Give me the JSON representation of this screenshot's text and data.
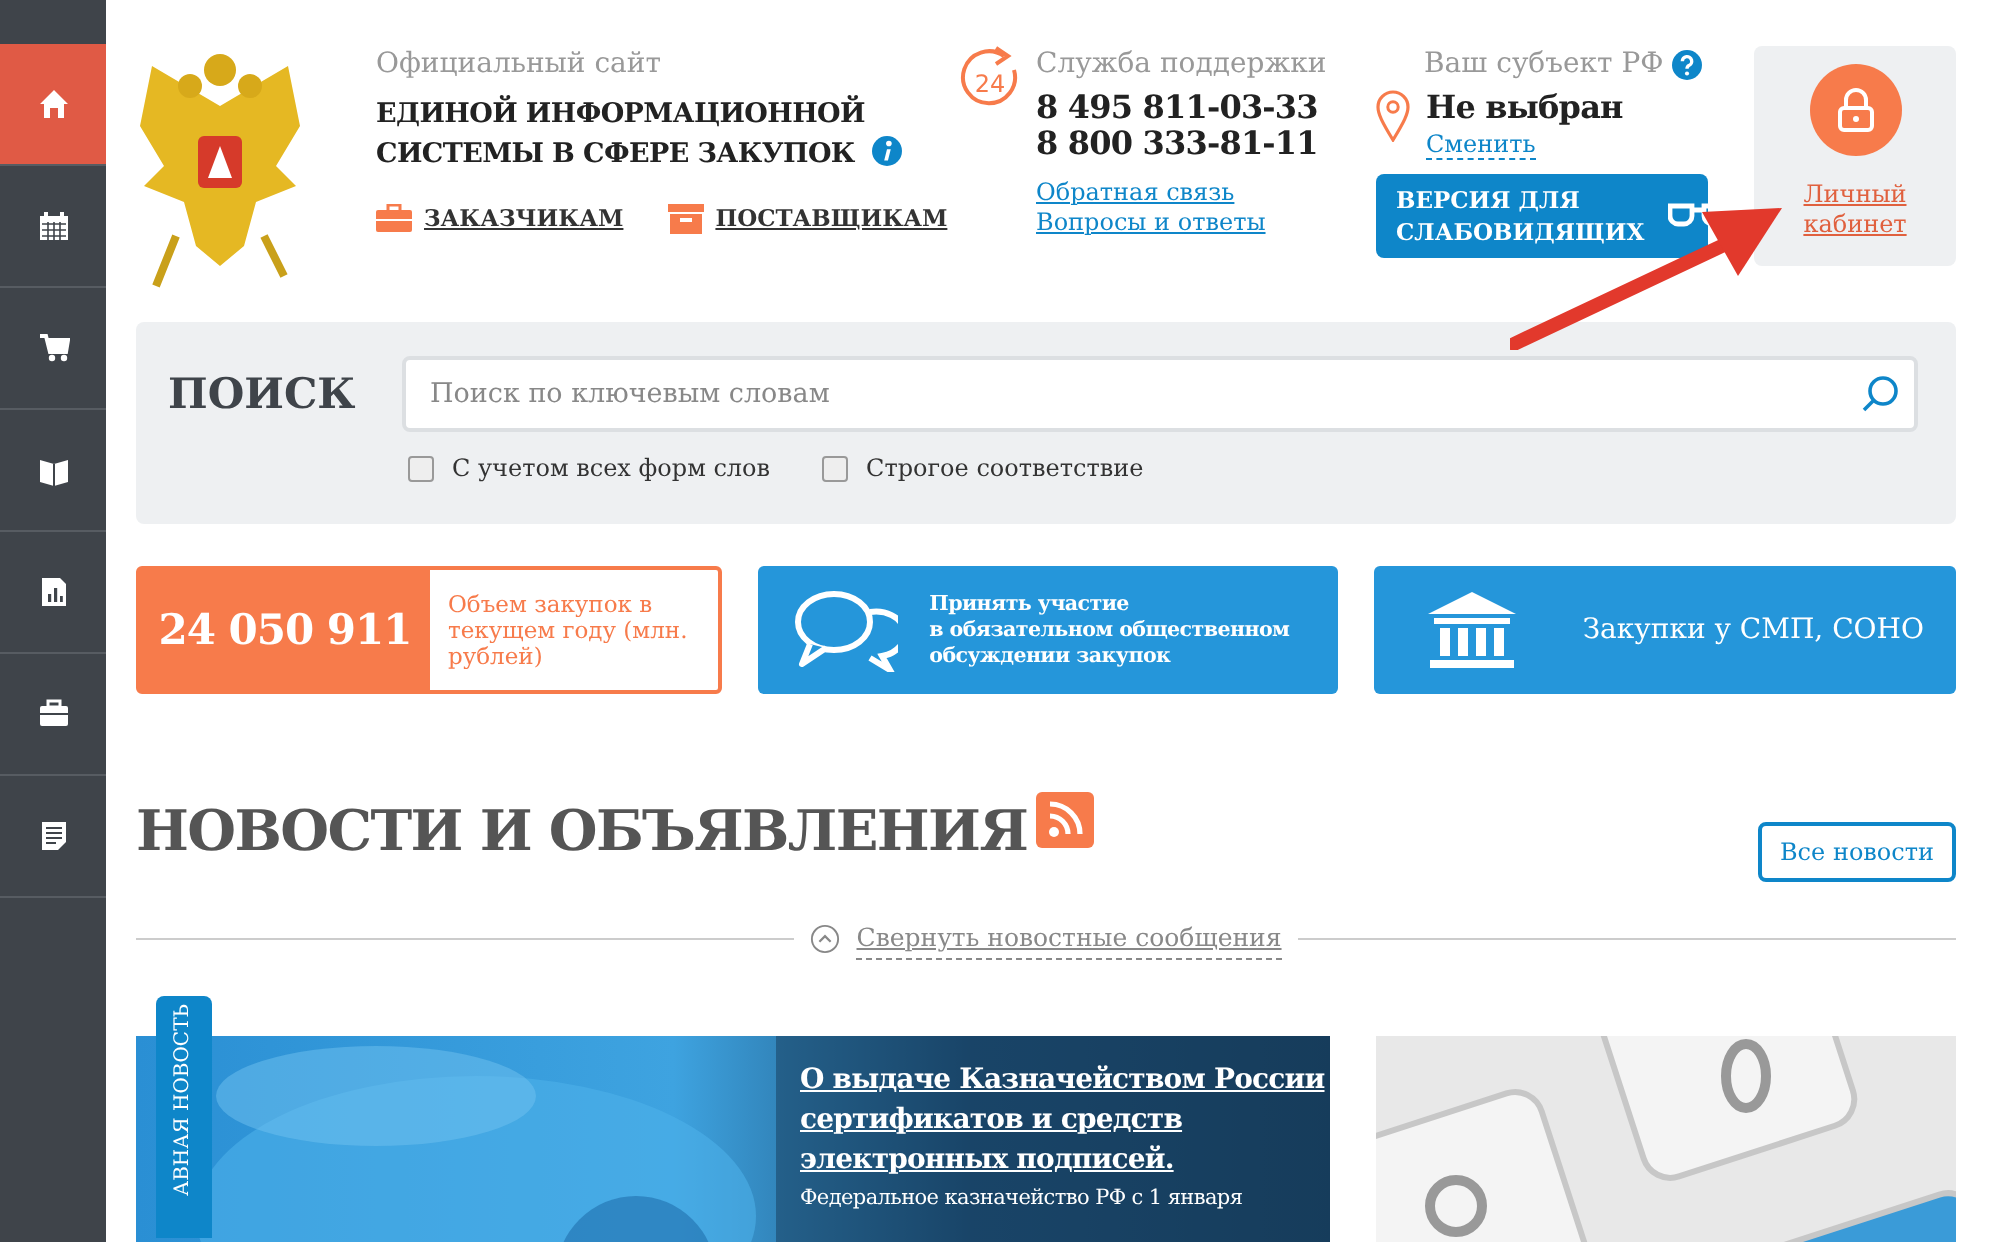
{
  "sidebar": {
    "items": [
      {
        "kind": "home",
        "selected": true
      },
      {
        "kind": "calendar",
        "selected": false
      },
      {
        "kind": "cart",
        "selected": false
      },
      {
        "kind": "book",
        "selected": false
      },
      {
        "kind": "report",
        "selected": false
      },
      {
        "kind": "briefcase",
        "selected": false
      },
      {
        "kind": "document",
        "selected": false
      }
    ]
  },
  "header": {
    "caption": "Официальный сайт",
    "title_lines": [
      "ЕДИНОЙ ИНФОРМАЦИОННОЙ",
      "СИСТЕМЫ В СФЕРЕ ЗАКУПОК"
    ],
    "audience_links": [
      {
        "kind": "briefcase",
        "label": "ЗАКАЗЧИКАМ"
      },
      {
        "kind": "box",
        "label": "ПОСТАВЩИКАМ"
      }
    ]
  },
  "support": {
    "caption": "Служба поддержки",
    "badge": "24",
    "phones": [
      "8 495 811-03-33",
      "8 800 333-81-11"
    ],
    "links": [
      "Обратная связь",
      "Вопросы и ответы"
    ]
  },
  "region": {
    "caption": "Ваш субъект РФ",
    "value": "Не выбран",
    "change_link": "Сменить"
  },
  "accessibility_button": {
    "lines": [
      "ВЕРСИЯ ДЛЯ",
      "СЛАБОВИДЯЩИХ"
    ]
  },
  "account": {
    "label": "Личный кабинет"
  },
  "search": {
    "title": "ПОИСК",
    "placeholder": "Поиск по ключевым словам",
    "options": [
      {
        "label": "С учетом всех форм слов",
        "checked": false
      },
      {
        "label": "Строгое соответствие",
        "checked": false
      }
    ]
  },
  "tiles": [
    {
      "kind": "stat",
      "value": "24 050 911",
      "caption": "Объем закупок в текущем году (млн. рублей)"
    },
    {
      "kind": "chat",
      "lines": [
        "Принять участие",
        "в обязательном общественном",
        "обсуждении закупок"
      ]
    },
    {
      "kind": "bank",
      "lines": [
        "Закупки у СМП, СОНО"
      ]
    }
  ],
  "news": {
    "title": "НОВОСТИ И ОБЪЯВЛЕНИЯ",
    "all_button": "Все новости",
    "collapse_link": "Свернуть новостные сообщения",
    "featured": {
      "tab": "АВНАЯ НОВОСТЬ",
      "headline": "О выдаче Казначейством России сертификатов и средств электронных подписей.",
      "excerpt": "Федеральное казначейство РФ с 1 января"
    }
  }
}
